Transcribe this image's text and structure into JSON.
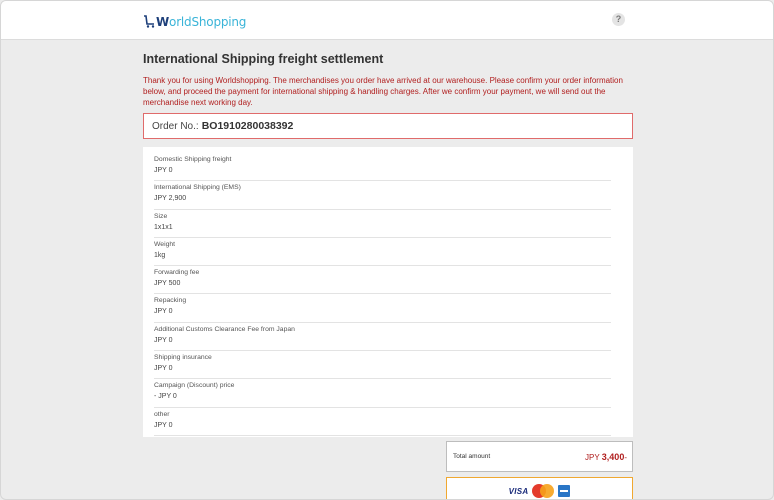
{
  "header": {
    "logo_first": "W",
    "logo_rest": "orldShopping",
    "help_label": "?"
  },
  "page": {
    "title": "International Shipping freight settlement",
    "notice": "Thank you for using Worldshopping. The merchandises you order have arrived at our warehouse. Please confirm your order information below, and proceed the payment for international shipping & handling charges. After we confirm your payment, we will send out the merchandise next working day."
  },
  "order": {
    "label": "Order No.:",
    "number": "BO1910280038392"
  },
  "details": [
    {
      "label": "Domestic Shipping freight",
      "value": "JPY 0"
    },
    {
      "label": "International Shipping (EMS)",
      "value": "JPY 2,900"
    },
    {
      "label": "Size",
      "value": "1x1x1"
    },
    {
      "label": "Weight",
      "value": "1kg"
    },
    {
      "label": "Forwarding fee",
      "value": "JPY 500"
    },
    {
      "label": "Repacking",
      "value": "JPY 0"
    },
    {
      "label": "Additional Customs Clearance Fee from Japan",
      "value": "JPY 0"
    },
    {
      "label": "Shipping insurance",
      "value": "JPY 0"
    },
    {
      "label": "Campaign (Discount) price",
      "value": "- JPY 0"
    },
    {
      "label": "other",
      "value": "JPY 0"
    }
  ],
  "total": {
    "label": "Total amount",
    "currency": "JPY",
    "amount": "3,400",
    "suffix": "-"
  },
  "payment": {
    "visa_label": "VISA",
    "icons": [
      "visa-icon",
      "mastercard-icon",
      "amex-icon"
    ]
  },
  "colors": {
    "accent_red": "#b12020",
    "order_border": "#e06b6b",
    "pay_border": "#f0a830",
    "logo_blue": "#3ab4d8"
  }
}
